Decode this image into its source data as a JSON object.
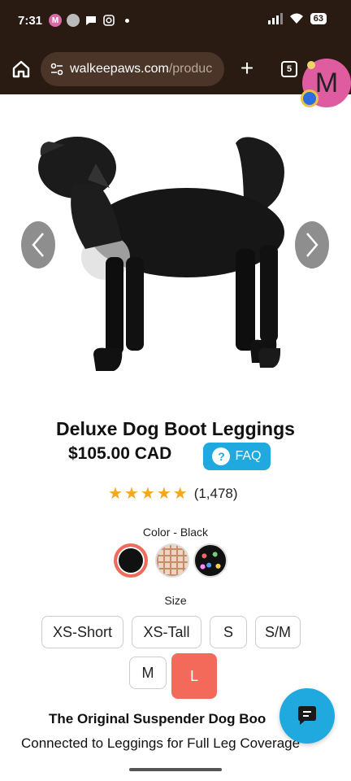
{
  "status_bar": {
    "time": "7:31",
    "notif_initial": "M",
    "battery": "63"
  },
  "browser": {
    "url_host": "walkeepaws.com",
    "url_rest": "/produc",
    "tab_count": "5",
    "profile_initial": "M"
  },
  "product": {
    "title": "Deluxe Dog Boot Leggings",
    "price": "$105.00 CAD",
    "faq_label": "FAQ",
    "faq_icon": "?",
    "rating_stars": 5,
    "rating_count": "(1,478)",
    "color_label": "Color - Black",
    "colors": [
      "black",
      "plaid",
      "polka-dot"
    ],
    "selected_color": "black",
    "size_label": "Size",
    "sizes": [
      "XS-Short",
      "XS-Tall",
      "S",
      "S/M",
      "M",
      "L"
    ],
    "selected_size": "L",
    "desc_title": "The Original Suspender Dog Boo",
    "desc_sub": "Connected to Leggings for Full Leg Coverage"
  },
  "colors": {
    "accent_coral": "#f36a5b",
    "faq_blue": "#1fa9df",
    "browser_bg": "#2a1b12"
  }
}
